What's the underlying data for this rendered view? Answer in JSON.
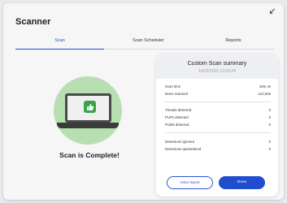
{
  "app": {
    "title": "Scanner"
  },
  "tabs": [
    {
      "label": "Scan",
      "active": true
    },
    {
      "label": "Scan Scheduler",
      "active": false
    },
    {
      "label": "Reports",
      "active": false
    }
  ],
  "status": {
    "message": "Scan is Complete!"
  },
  "summary": {
    "title": "Custom Scan summary",
    "date": "14/02/2025 13:32:24",
    "rows": [
      {
        "label": "Scan time",
        "value": "10m 4s"
      },
      {
        "label": "Items scanned",
        "value": "212,815"
      },
      {
        "label": "Threats detected",
        "value": "0"
      },
      {
        "label": "PUPs detected",
        "value": "0"
      },
      {
        "label": "PUMs detected",
        "value": "0"
      },
      {
        "label": "Detections ignored",
        "value": "0"
      },
      {
        "label": "Detections quarantined",
        "value": "0"
      }
    ],
    "view_report_label": "View report",
    "done_label": "Done"
  },
  "icons": {
    "collapse": "collapse-arrow-icon",
    "illustration": "laptop-thumbs-up-icon"
  },
  "colors": {
    "accent": "#1f4fcf",
    "success_bg": "#b7dfb1",
    "success": "#39a447"
  }
}
